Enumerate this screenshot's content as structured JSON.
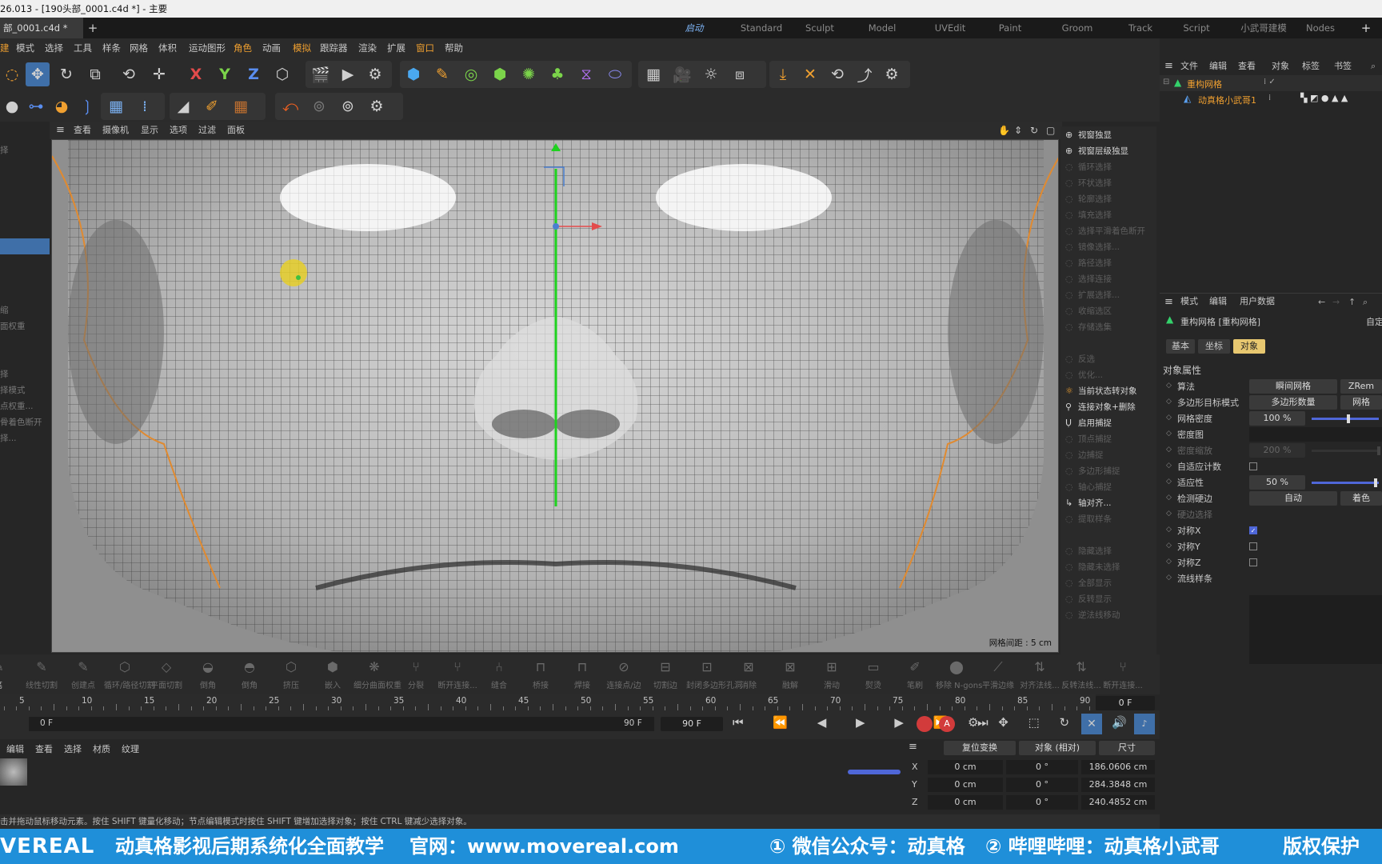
{
  "titlebar": {
    "text": "26.013 - [190头部_0001.c4d *] - 主要"
  },
  "tabs": {
    "doc_tab": "部_0001.c4d *",
    "add": "+",
    "workspaces": [
      "启动",
      "Standard",
      "Sculpt",
      "Model",
      "UVEdit",
      "Paint",
      "Groom",
      "Track",
      "Script",
      "小武哥建模",
      "Nodes"
    ],
    "ws_add": "+"
  },
  "menu": {
    "items": [
      "建",
      "模式",
      "选择",
      "工具",
      "样条",
      "网格",
      "体积",
      "运动图形",
      "角色",
      "动画",
      "模拟",
      "跟踪器",
      "渲染",
      "扩展",
      "窗口",
      "帮助"
    ]
  },
  "toolbar": {
    "axis_x": "X",
    "axis_y": "Y",
    "axis_z": "Z"
  },
  "leftpanel": {
    "items": [
      "择",
      "",
      "",
      "",
      "",
      "",
      "",
      "",
      "",
      "",
      "缩",
      "面权重",
      "",
      "",
      "择",
      "择模式",
      "点权重...",
      "骨着色断开",
      "择..."
    ]
  },
  "viewport_menu": {
    "items": [
      "查看",
      "摄像机",
      "显示",
      "选项",
      "过滤",
      "面板"
    ],
    "grid_distance": "网格间距 : 5 cm"
  },
  "rightpanel": {
    "items": [
      {
        "label": "视窗独显",
        "on": true
      },
      {
        "label": "视窗层级独显",
        "on": true
      },
      {
        "label": "循环选择",
        "on": false
      },
      {
        "label": "环状选择",
        "on": false
      },
      {
        "label": "轮廓选择",
        "on": false
      },
      {
        "label": "填充选择",
        "on": false
      },
      {
        "label": "选择平滑着色断开",
        "on": false
      },
      {
        "label": "镜像选择...",
        "on": false
      },
      {
        "label": "路径选择",
        "on": false
      },
      {
        "label": "选择连接",
        "on": false
      },
      {
        "label": "扩展选择...",
        "on": false
      },
      {
        "label": "收缩选区",
        "on": false
      },
      {
        "label": "存储选集",
        "on": false
      },
      {
        "label": "",
        "on": false
      },
      {
        "label": "反选",
        "on": false
      },
      {
        "label": "优化...",
        "on": false
      },
      {
        "label": "当前状态转对象",
        "on": true
      },
      {
        "label": "连接对象+删除",
        "on": true
      },
      {
        "label": "启用捕捉",
        "on": true
      },
      {
        "label": "顶点捕捉",
        "on": false
      },
      {
        "label": "边捕捉",
        "on": false
      },
      {
        "label": "多边形捕捉",
        "on": false
      },
      {
        "label": "轴心捕捉",
        "on": false
      },
      {
        "label": "轴对齐...",
        "on": true
      },
      {
        "label": "提取样条",
        "on": false
      },
      {
        "label": "",
        "on": false
      },
      {
        "label": "隐藏选择",
        "on": false
      },
      {
        "label": "隐藏未选择",
        "on": false
      },
      {
        "label": "全部显示",
        "on": false
      },
      {
        "label": "反转显示",
        "on": false
      },
      {
        "label": "逆法线移动",
        "on": false
      }
    ]
  },
  "object_manager": {
    "menu": [
      "文件",
      "编辑",
      "查看",
      "对象",
      "标签",
      "书签"
    ],
    "objects": [
      {
        "name": "重构网格"
      },
      {
        "name": "动真格小武哥1"
      }
    ]
  },
  "attributes": {
    "menu": [
      "模式",
      "编辑",
      "用户数据"
    ],
    "title": "重构网格 [重构网格]",
    "auto": "自定",
    "tabs": [
      "基本",
      "坐标",
      "对象"
    ],
    "section": "对象属性",
    "rows": [
      {
        "label": "算法",
        "value": "瞬间网格",
        "value2": "ZRem"
      },
      {
        "label": "多边形目标模式",
        "value": "多边形数量",
        "value2": "网格"
      },
      {
        "label": "网格密度",
        "value": "100 %"
      },
      {
        "label": "密度图",
        "value": ""
      },
      {
        "label": "密度缩放",
        "value": "200 %"
      },
      {
        "label": "自适应计数",
        "value": ""
      },
      {
        "label": "适应性",
        "value": "50 %"
      },
      {
        "label": "检测硬边",
        "value": "自动",
        "value2": "着色"
      },
      {
        "label": "硬边选择",
        "value": ""
      },
      {
        "label": "对称X",
        "value": ""
      },
      {
        "label": "对称Y",
        "value": ""
      },
      {
        "label": "对称Z",
        "value": ""
      },
      {
        "label": "流线样条",
        "value": ""
      }
    ],
    "adaptive_count_checked": false,
    "sym_x_checked": true,
    "sym_y_checked": false,
    "sym_z_checked": false
  },
  "commands": [
    "笔",
    "线性切割",
    "创建点",
    "循环/路径切割",
    "平面切割",
    "倒角",
    "倒角",
    "挤压",
    "嵌入",
    "细分曲面权重",
    "分裂",
    "断开连接...",
    "缝合",
    "桥接",
    "焊接",
    "连接点/边",
    "切割边",
    "封闭多边形孔洞",
    "消除",
    "融解",
    "滑动",
    "熨烫",
    "笔刷",
    "移除 N-gons",
    "平滑边缘",
    "对齐法线...",
    "反转法线...",
    "断开连接..."
  ],
  "ruler": {
    "ticks": [
      "5",
      "10",
      "15",
      "20",
      "25",
      "30",
      "35",
      "40",
      "45",
      "50",
      "55",
      "60",
      "65",
      "70",
      "75",
      "80",
      "85",
      "90"
    ],
    "frame_field": "0 F"
  },
  "playbar": {
    "start": "0 F",
    "end": "90 F",
    "end2": "90 F"
  },
  "material": {
    "menu": [
      "编辑",
      "查看",
      "选择",
      "材质",
      "纹理"
    ]
  },
  "coords": {
    "reset": "复位变换",
    "mode": "对象 (相对)",
    "size": "尺寸",
    "rows": [
      {
        "axis": "X",
        "pos": "0 cm",
        "rot": "0 °",
        "size": "186.0606 cm"
      },
      {
        "axis": "Y",
        "pos": "0 cm",
        "rot": "0 °",
        "size": "284.3848 cm"
      },
      {
        "axis": "Z",
        "pos": "0 cm",
        "rot": "0 °",
        "size": "240.4852 cm"
      }
    ]
  },
  "status": {
    "text": "击并拖动鼠标移动元素。按住 SHIFT 键量化移动；节点编辑模式时按住 SHIFT 键增加选择对象；按住 CTRL 键减少选择对象。"
  },
  "banner": {
    "logo": "VEREAL",
    "a": "动真格影视后期系统化全面教学",
    "b": "官网：www.movereal.com",
    "c": "① 微信公众号：动真格",
    "d": "② 哔哩哔哩：动真格小武哥",
    "e": "版权保护 "
  }
}
